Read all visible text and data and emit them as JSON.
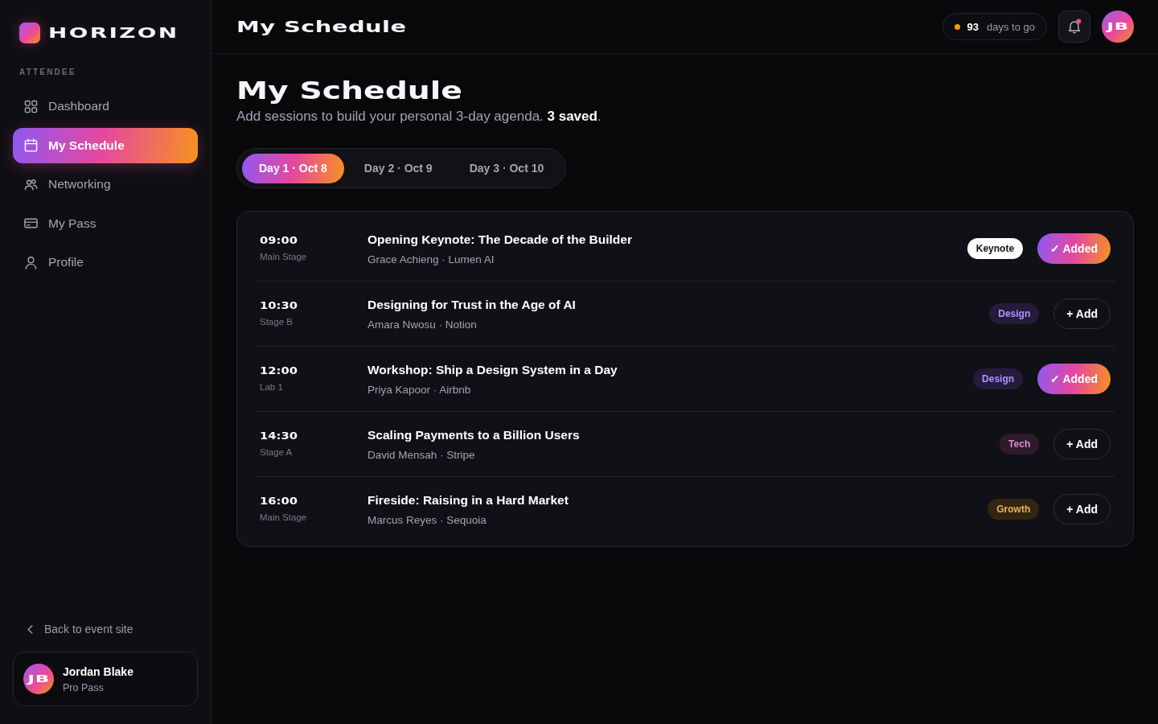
{
  "brand": {
    "name": "HORIZON"
  },
  "sidebar": {
    "section": "ATTENDEE",
    "items": [
      {
        "label": "Dashboard",
        "selected": false
      },
      {
        "label": "My Schedule",
        "selected": true
      },
      {
        "label": "Networking",
        "selected": false
      },
      {
        "label": "My Pass",
        "selected": false
      },
      {
        "label": "Profile",
        "selected": false
      }
    ],
    "back_link": "Back to event site",
    "user": {
      "initials": "JB",
      "name": "Jordan Blake",
      "plan": "Pro Pass"
    }
  },
  "topbar": {
    "title": "My Schedule",
    "countdown": {
      "value": "93",
      "label": "days to go"
    },
    "notifications": {
      "unread": true
    },
    "avatar": {
      "initials": "JB"
    }
  },
  "page": {
    "title": "My Schedule",
    "subtitle": "Add sessions to build your personal 3-day agenda. **3 saved**."
  },
  "day_tabs": [
    {
      "label": "Day 1 · Oct 8",
      "selected": true
    },
    {
      "label": "Day 2 · Oct 9",
      "selected": false
    },
    {
      "label": "Day 3 · Oct 10",
      "selected": false
    }
  ],
  "sessions": [
    {
      "time": "09:00",
      "room": "Main Stage",
      "title": "Opening Keynote: The Decade of the Builder",
      "speaker": "Grace Achieng · Lumen AI",
      "tag": {
        "label": "Keynote",
        "kind": "solid",
        "color": "#ffffff"
      },
      "added": true,
      "action": "✓ Added"
    },
    {
      "time": "10:30",
      "room": "Stage B",
      "title": "Designing for Trust in the Age of AI",
      "speaker": "Amara Nwosu · Notion",
      "tag": {
        "label": "Design",
        "kind": "soft",
        "color": "#241c3b"
      },
      "added": false,
      "action": "+ Add"
    },
    {
      "time": "12:00",
      "room": "Lab 1",
      "title": "Workshop: Ship a Design System in a Day",
      "speaker": "Priya Kapoor · Airbnb",
      "tag": {
        "label": "Design",
        "kind": "soft",
        "color": "#241c3b"
      },
      "added": true,
      "action": "✓ Added"
    },
    {
      "time": "14:30",
      "room": "Stage A",
      "title": "Scaling Payments to a Billion Users",
      "speaker": "David Mensah · Stripe",
      "tag": {
        "label": "Tech",
        "kind": "soft",
        "color": "#2f1b2b"
      },
      "added": false,
      "action": "+ Add"
    },
    {
      "time": "16:00",
      "room": "Main Stage",
      "title": "Fireside: Raising in a Hard Market",
      "speaker": "Marcus Reyes · Sequoia",
      "tag": {
        "label": "Growth",
        "kind": "soft",
        "color": "#33250f"
      },
      "added": false,
      "action": "+ Add"
    }
  ]
}
